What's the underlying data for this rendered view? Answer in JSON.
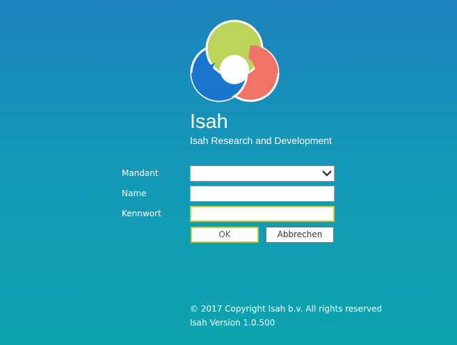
{
  "app": {
    "title": "Isah",
    "subtitle": "Isah Research and Development"
  },
  "form": {
    "mandant_label": "Mandant",
    "mandant_value": "",
    "name_label": "Name",
    "name_value": "",
    "password_label": "Kennwort",
    "password_value": ""
  },
  "buttons": {
    "ok_label": "OK",
    "cancel_label": "Abbrechen"
  },
  "footer": {
    "copyright": "© 2017 Copyright Isah b.v. All rights reserved",
    "version": "Isah Version 1.0.500"
  },
  "colors": {
    "background_top": "#1d83bd",
    "background_bottom": "#0da4ae",
    "logo_green": "#bcd45a",
    "logo_blue": "#1976cf",
    "logo_red": "#f07466",
    "focus_border": "#b6d63e"
  },
  "icons": {
    "logo": "isah-logo",
    "dropdown": "chevron-down-icon"
  }
}
